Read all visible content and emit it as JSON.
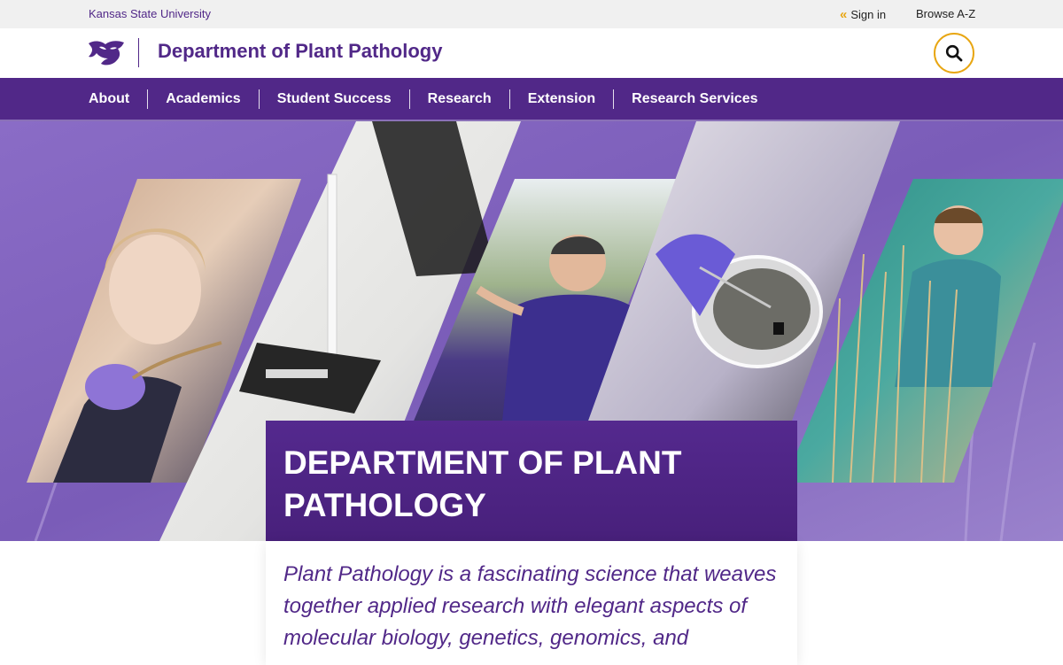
{
  "utility": {
    "university": "Kansas State University",
    "sign_in": "Sign in",
    "browse": "Browse A-Z"
  },
  "header": {
    "title": "Department of Plant Pathology",
    "logo_icon": "wildcat-logo-icon",
    "search_icon": "search-icon"
  },
  "nav": {
    "items": [
      {
        "label": "About"
      },
      {
        "label": "Academics"
      },
      {
        "label": "Student Success"
      },
      {
        "label": "Research"
      },
      {
        "label": "Extension"
      },
      {
        "label": "Research Services"
      }
    ]
  },
  "hero": {
    "title": "Department of Plant Pathology",
    "intro": "Plant Pathology is a fascinating science that weaves together applied research with elegant aspects of molecular biology, genetics, genomics, and"
  },
  "colors": {
    "purple": "#512888",
    "gold": "#e8a612",
    "utility_bg": "#f0f0f0"
  }
}
